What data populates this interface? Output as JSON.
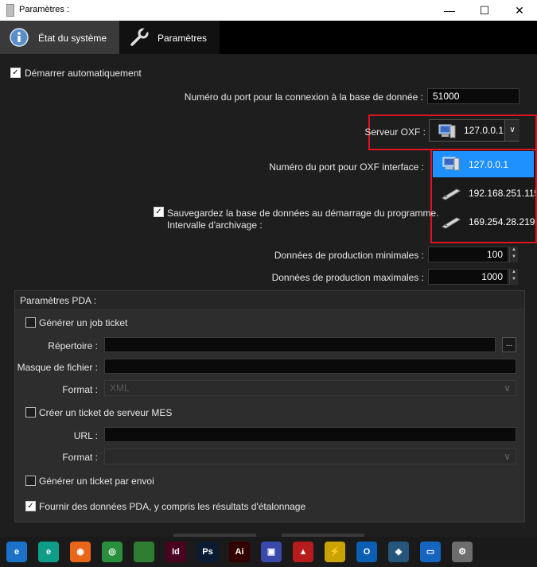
{
  "window": {
    "title": "Paramètres :"
  },
  "tabs": [
    {
      "label": "État du système"
    },
    {
      "label": "Paramètres"
    }
  ],
  "general": {
    "autostart_label": "Démarrer automatiquement",
    "db_port_label": "Numéro du port pour la connexion à la base de donnée :",
    "db_port_value": "51000",
    "oxf_server_label": "Serveur OXF :",
    "oxf_server_value": "127.0.0.1",
    "oxf_port_label": "Numéro du port pour OXF interface :",
    "backup_label_1": "Sauvegardez la base de données au démarrage du programme.",
    "backup_label_2": "Intervalle d'archivage :",
    "min_label": "Données de production minimales :",
    "min_value": "100",
    "max_label": "Données de production maximales :",
    "max_value": "1000"
  },
  "dropdown": {
    "options": [
      "127.0.0.1",
      "192.168.251.115",
      "169.254.28.219"
    ],
    "selected_index": 0
  },
  "pda": {
    "header": "Paramètres PDA :",
    "job_ticket_label": "Générer un job ticket",
    "directory_label": "Répertoire :",
    "browse_label": "...",
    "file_mask_label": "Masque de fichier :",
    "format_label": "Format :",
    "format_value": "XML",
    "mes_ticket_label": "Créer un ticket de serveur MES",
    "url_label": "URL :",
    "format2_label": "Format :",
    "per_send_label": "Générer un ticket par envoi",
    "provide_label": "Fournir des données PDA, y compris les résultats d'étalonnage"
  },
  "window_controls": {
    "minimize": "—",
    "maximize": "☐",
    "close": "✕"
  },
  "colors": {
    "highlight_red": "#e0141e",
    "selection_blue": "#1e90ff"
  },
  "taskbar": [
    {
      "icon": "edge-legacy-icon",
      "glyph": "e",
      "color": "#1a73c8"
    },
    {
      "icon": "edge-icon",
      "glyph": "e",
      "color": "#0f9d8a"
    },
    {
      "icon": "firefox-icon",
      "glyph": "◉",
      "color": "#e8651a"
    },
    {
      "icon": "chrome-icon",
      "glyph": "◎",
      "color": "#2a8f3c"
    },
    {
      "icon": "indesign-app-icon",
      "glyph": "",
      "color": "#2e7d32"
    },
    {
      "icon": "indesign-icon",
      "glyph": "Id",
      "color": "#49021f"
    },
    {
      "icon": "photoshop-icon",
      "glyph": "Ps",
      "color": "#0a1c33"
    },
    {
      "icon": "illustrator-icon",
      "glyph": "Ai",
      "color": "#330000"
    },
    {
      "icon": "save-app-icon",
      "glyph": "▣",
      "color": "#3949ab"
    },
    {
      "icon": "acrobat-icon",
      "glyph": "▲",
      "color": "#b71c1c"
    },
    {
      "icon": "sun-app-icon",
      "glyph": "⚡",
      "color": "#c9a300"
    },
    {
      "icon": "outlook-icon",
      "glyph": "O",
      "color": "#0a5fb4"
    },
    {
      "icon": "cube-app-icon",
      "glyph": "◆",
      "color": "#26577a"
    },
    {
      "icon": "window-app-icon",
      "glyph": "▭",
      "color": "#1565c0"
    },
    {
      "icon": "settings-app-icon",
      "glyph": "⚙",
      "color": "#6d6d6d"
    }
  ]
}
